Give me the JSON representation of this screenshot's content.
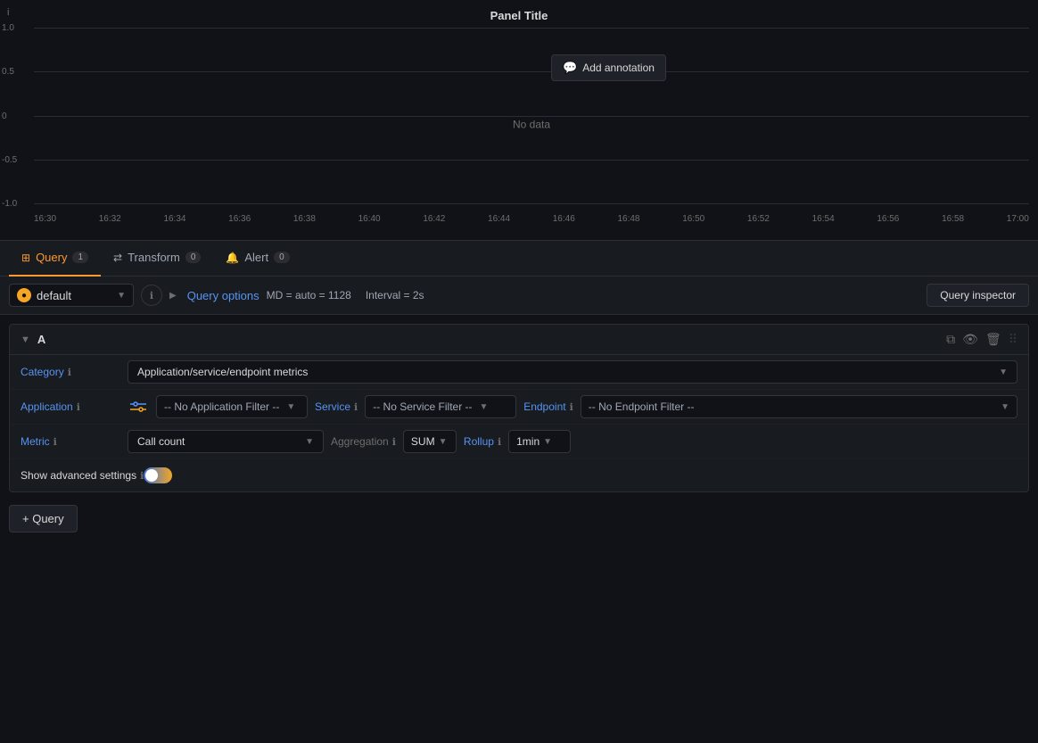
{
  "panel": {
    "title": "Panel Title",
    "info_icon": "i",
    "no_data_label": "No data",
    "annotation_label": "Add annotation",
    "y_axis": [
      "1.0",
      "0.5",
      "0",
      "-0.5",
      "-1.0"
    ],
    "x_axis": [
      "16:30",
      "16:32",
      "16:34",
      "16:36",
      "16:38",
      "16:40",
      "16:42",
      "16:44",
      "16:46",
      "16:48",
      "16:50",
      "16:52",
      "16:54",
      "16:56",
      "16:58",
      "17:00"
    ]
  },
  "tabs": [
    {
      "id": "query",
      "label": "Query",
      "count": "1",
      "active": true
    },
    {
      "id": "transform",
      "label": "Transform",
      "count": "0",
      "active": false
    },
    {
      "id": "alert",
      "label": "Alert",
      "count": "0",
      "active": false
    }
  ],
  "datasource": {
    "name": "default",
    "icon": "●"
  },
  "query_options": {
    "label": "Query options",
    "meta": "MD = auto = 1128",
    "interval": "Interval = 2s"
  },
  "query_inspector": {
    "label": "Query inspector"
  },
  "query_block": {
    "id": "A",
    "category_label": "Category",
    "category_value": "Application/service/endpoint metrics",
    "application_label": "Application",
    "application_filter": "-- No Application Filter --",
    "service_label": "Service",
    "service_filter": "-- No Service Filter --",
    "endpoint_label": "Endpoint",
    "endpoint_filter": "-- No Endpoint Filter --",
    "metric_label": "Metric",
    "metric_value": "Call count",
    "aggregation_label": "Aggregation",
    "aggregation_value": "SUM",
    "rollup_label": "Rollup",
    "rollup_value": "1min",
    "show_advanced_label": "Show advanced settings"
  },
  "add_query": {
    "label": "+ Query"
  }
}
